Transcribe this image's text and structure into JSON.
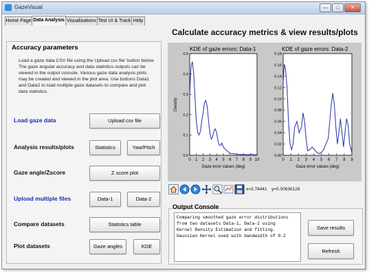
{
  "window": {
    "title": "GazeVisual"
  },
  "tabs": [
    "Home Page",
    "Data Analysis",
    "Visualizations",
    "Test UI & Track",
    "Help"
  ],
  "heading": "Calculate accuracy metrics & view results/plots",
  "left": {
    "section_title": "Accuracy parameters",
    "description": "Load a gaze data CSV file using the Upload csv file' button below. The gaze angular accuracy and data statistics outputs can be viewed in the output console. Various gaze data analysis plots may be created and viewed in the plot area. Use buttons Data1 and Data2 to load multiple gaze datasets to compare and plot data statistics.",
    "rows": {
      "load": {
        "label": "Load gaze data",
        "button": "Upload csv file"
      },
      "analysis": {
        "label": "Analysis results/plots",
        "buttons": [
          "Statistics",
          "Yaw/Pitch"
        ]
      },
      "angle": {
        "label": "Gaze angle/Zscore",
        "button": "Z score plot"
      },
      "multiple": {
        "label": "Upload multiple files",
        "buttons": [
          "Data-1",
          "Data-2"
        ]
      },
      "compare": {
        "label": "Compare datasets",
        "button": "Statistics table"
      },
      "plot": {
        "label": "Plot datasets",
        "buttons": [
          "Gaze angles",
          "KDE"
        ]
      }
    }
  },
  "toolbar": {
    "icons": [
      "home-icon",
      "back-arrow-icon",
      "forward-arrow-icon",
      "pan-icon",
      "zoom-icon",
      "configure-icon",
      "save-icon"
    ],
    "x_readout": "x=3.78441",
    "y_readout": "y=0.00636126"
  },
  "console": {
    "label": "Output Console",
    "text": "Comparing smoothed gaze error distributions\nfrom two datasets Data-1, Data-2 using\nKernel Density Estimation and fitting.\nGaussian Kernel used with bandwidth of 0.2",
    "buttons": [
      "Save results",
      "Refresh"
    ]
  },
  "colors": {
    "curve": "#3340a6",
    "plot_bg": "#c9c9c9",
    "heading_blue": "#1c2bb0"
  },
  "chart_data": [
    {
      "type": "line",
      "title": "KDE of gaze errors: Data-1",
      "xlabel": "Gaze error values (deg)",
      "ylabel": "Density",
      "xlim": [
        0,
        10
      ],
      "ylim": [
        0,
        0.5
      ],
      "xticks": [
        "0",
        "1",
        "2",
        "3",
        "4",
        "5",
        "6",
        "7",
        "8",
        "9",
        "10"
      ],
      "yticks": [
        "0.0",
        "0.1",
        "0.2",
        "0.3",
        "0.4",
        "0.5"
      ],
      "x": [
        0,
        0.2,
        0.4,
        0.6,
        0.8,
        1.0,
        1.2,
        1.4,
        1.6,
        1.8,
        2.0,
        2.2,
        2.4,
        2.6,
        2.8,
        3.0,
        3.2,
        3.4,
        3.6,
        3.8,
        4.0,
        4.2,
        4.4,
        4.6,
        4.8,
        5.0,
        5.3,
        5.6,
        6.0,
        6.4,
        6.8,
        7.2,
        7.6,
        8.0,
        8.4,
        8.8,
        9.2,
        9.6,
        10
      ],
      "y": [
        0.3,
        0.44,
        0.46,
        0.4,
        0.28,
        0.16,
        0.11,
        0.1,
        0.12,
        0.17,
        0.21,
        0.26,
        0.27,
        0.24,
        0.17,
        0.11,
        0.08,
        0.09,
        0.12,
        0.13,
        0.11,
        0.07,
        0.05,
        0.05,
        0.06,
        0.04,
        0.03,
        0.02,
        0.01,
        0.008,
        0.006,
        0.005,
        0.004,
        0.003,
        0.003,
        0.003,
        0.005,
        0.003,
        0.001
      ]
    },
    {
      "type": "line",
      "title": "KDE of gaze errors: Data-2",
      "xlabel": "Gaze error values (deg)",
      "ylabel": "",
      "xlim": [
        0,
        9
      ],
      "ylim": [
        0,
        0.18
      ],
      "xticks": [
        "0",
        "1",
        "2",
        "3",
        "4",
        "5",
        "6",
        "7",
        "8",
        "9"
      ],
      "yticks": [
        "0.00",
        "0.02",
        "0.04",
        "0.06",
        "0.08",
        "0.10",
        "0.12",
        "0.14",
        "0.16",
        "0.18"
      ],
      "x": [
        0,
        0.15,
        0.3,
        0.5,
        0.7,
        0.9,
        1.1,
        1.3,
        1.5,
        1.8,
        2.1,
        2.4,
        2.6,
        2.8,
        3.0,
        3.2,
        3.5,
        3.8,
        4.1,
        4.4,
        4.7,
        5.0,
        5.3,
        5.6,
        5.9,
        6.1,
        6.3,
        6.5,
        6.7,
        6.9,
        7.1,
        7.3,
        7.5,
        7.7,
        7.9,
        8.1,
        8.3,
        8.5,
        8.7,
        9.0
      ],
      "y": [
        0.13,
        0.16,
        0.155,
        0.12,
        0.06,
        0.02,
        0.01,
        0.02,
        0.05,
        0.06,
        0.04,
        0.05,
        0.075,
        0.06,
        0.03,
        0.008,
        0.01,
        0.015,
        0.01,
        0.005,
        0.003,
        0.005,
        0.01,
        0.02,
        0.03,
        0.06,
        0.09,
        0.11,
        0.09,
        0.05,
        0.02,
        0.04,
        0.065,
        0.04,
        0.015,
        0.04,
        0.065,
        0.055,
        0.02,
        0.005
      ]
    }
  ]
}
